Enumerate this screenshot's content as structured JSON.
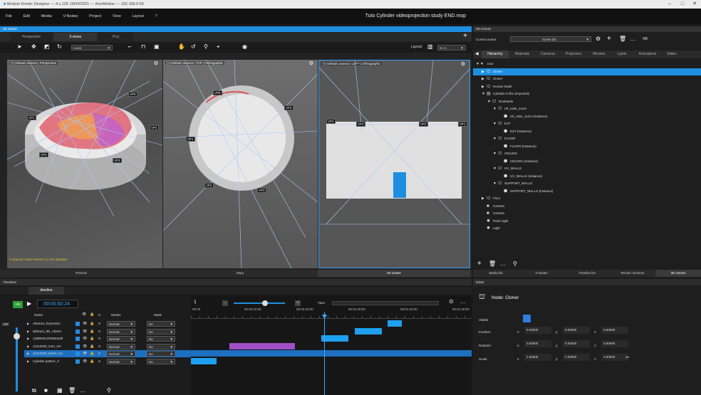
{
  "window": {
    "title": "Modulo Kinetic Designer --- 4.x.105 19/04/2021 --- KineMotion --- 192.168.0.69",
    "min": "–",
    "max": "□",
    "close": "✕"
  },
  "menu": [
    "File",
    "Edit",
    "Media",
    "V-Nodes",
    "Project",
    "View",
    "Layout",
    "?"
  ],
  "project_title": "Tuto Cylinder videoprojection study END.mop",
  "viewer": {
    "header": "3D viewer",
    "tabs": [
      "Perspective",
      "3-views",
      "Proj"
    ],
    "local": "Local",
    "layout_label": "Layout",
    "layout_value": "3 x 1",
    "views": [
      {
        "label": "[+] Default camera | Perspective",
        "status": "4 objects | 1044 vertices | 1,714 triangles"
      },
      {
        "label": "[+] Default camera | TOP | Orthographic"
      },
      {
        "label": "[+] Default camera | LEFT | Orthographic"
      }
    ],
    "bottom_tabs": [
      "Preview",
      "Warp",
      "3D viewer"
    ]
  },
  "scenes": {
    "header": "3D scenes",
    "current_label": "Current scene:",
    "current_value": "Scene 3D",
    "vr": "VR",
    "tabs": [
      "Hierarchy",
      "Materials",
      "Cameras",
      "Projectors",
      "Meshes",
      "Lights",
      "Animations",
      "Slides"
    ],
    "tree": [
      {
        "label": "root",
        "depth": 0,
        "icon": "root"
      },
      {
        "label": "Cloner",
        "depth": 1,
        "icon": "node",
        "sel": true
      },
      {
        "label": "Cloner",
        "depth": 1,
        "icon": "node"
      },
      {
        "label": "Human Node",
        "depth": 1,
        "icon": "node"
      },
      {
        "label": "Cylinder-m.fbx (Imported)",
        "depth": 1,
        "icon": "file"
      },
      {
        "label": "RootNode",
        "depth": 2,
        "icon": "node"
      },
      {
        "label": "ref_cube_1x1m",
        "depth": 3,
        "icon": "node"
      },
      {
        "label": "ref_cube_1x1m (Instance)",
        "depth": 4,
        "icon": "inst"
      },
      {
        "label": "EXT",
        "depth": 3,
        "icon": "node"
      },
      {
        "label": "EXT (Instance)",
        "depth": 4,
        "icon": "inst"
      },
      {
        "label": "FLOOR",
        "depth": 3,
        "icon": "node"
      },
      {
        "label": "FLOOR (Instance)",
        "depth": 4,
        "icon": "inst"
      },
      {
        "label": "CEILING",
        "depth": 3,
        "icon": "node"
      },
      {
        "label": "CEILING (Instance)",
        "depth": 4,
        "icon": "inst"
      },
      {
        "label": "UV_WALLS",
        "depth": 3,
        "icon": "node"
      },
      {
        "label": "UV_WALLS (Instance)",
        "depth": 4,
        "icon": "inst"
      },
      {
        "label": "SUPPORT_WALLS",
        "depth": 3,
        "icon": "node"
      },
      {
        "label": "SUPPORT_WALLS (Instance)",
        "depth": 4,
        "icon": "inst"
      },
      {
        "label": "Floor",
        "depth": 1,
        "icon": "node"
      },
      {
        "label": "Camera",
        "depth": 1,
        "icon": "camera"
      },
      {
        "label": "Camera",
        "depth": 1,
        "icon": "camera"
      },
      {
        "label": "Point Light",
        "depth": 1,
        "icon": "light"
      },
      {
        "label": "Light",
        "depth": 1,
        "icon": "light"
      }
    ],
    "bottom_tabs": [
      "Media list",
      "V-Nodes",
      "Timeline list",
      "Render surfaces",
      "3D scenes"
    ]
  },
  "editor": {
    "header": "Editor",
    "node": "Node: Cloner",
    "visible": "Visible:",
    "position": "Position:",
    "rotation": "Rotation:",
    "scale": "Scale:",
    "pos": [
      "0.00000",
      "0.00000",
      "0.00000"
    ],
    "rot": [
      "0.00000",
      "0.00000",
      "0.00000"
    ],
    "scl": [
      "1.00000",
      "1.00000",
      "1.00000"
    ],
    "axes": [
      "x:",
      "y:",
      "z:"
    ]
  },
  "timelines": {
    "header": "Timelines",
    "tab": "timeline",
    "on": "ON",
    "time": "00:00:50:24",
    "col_name": "Name",
    "col_modes": "Modes",
    "col_mask": "Mask",
    "view": "View:",
    "s": "S",
    "level": "100",
    "ticks": [
      "00:00",
      "00:00:20:00",
      "00:00:40:00",
      "00:01:00:00",
      "00:01:20:00",
      "00:01:40:00"
    ],
    "layers": [
      {
        "name": "Abstract_Expressio",
        "mode": "Normal",
        "mask": "No"
      },
      {
        "name": "abstract_3D_Abstra",
        "mode": "Normal",
        "mask": "No"
      },
      {
        "name": "13d6818c20058a2d0",
        "mode": "Normal",
        "mask": "No"
      },
      {
        "name": "12112020_intro_HA",
        "mode": "Normal",
        "mask": "No"
      },
      {
        "name": "12112020_MAIN_Ca",
        "mode": "Normal",
        "mask": "No",
        "sel": true
      },
      {
        "name": "Cylinder pattern_3",
        "mode": "Normal",
        "mask": "No"
      }
    ]
  },
  "colors": {
    "accent": "#1e8fe0",
    "purple": "#a050c8",
    "clip": "#1ea0f0"
  }
}
